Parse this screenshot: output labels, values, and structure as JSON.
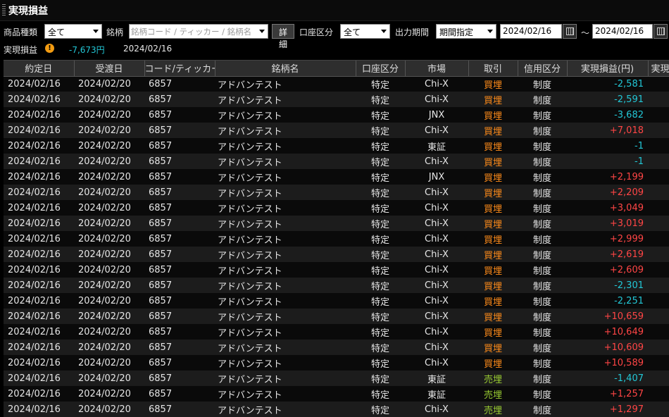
{
  "window": {
    "title": "実現損益"
  },
  "filters": {
    "product_type_label": "商品種類",
    "product_type_value": "全て",
    "symbol_label": "銘柄",
    "symbol_placeholder": "銘柄コード / ティッカー / 銘柄名",
    "detail_button": "詳細",
    "account_label": "口座区分",
    "account_value": "全て",
    "period_label": "出力期間",
    "period_value": "期間指定",
    "date_from": "2024/02/16",
    "range_sep": "～",
    "date_to": "2024/02/16"
  },
  "summary": {
    "label": "実現損益",
    "warn_icon": "!",
    "amount": "-7,673円",
    "date": "2024/02/16"
  },
  "table": {
    "columns": [
      "約定日",
      "受渡日",
      "コード/ティッカー",
      "銘柄名",
      "口座区分",
      "市場",
      "取引",
      "信用区分",
      "実現損益(円)",
      "実現"
    ],
    "rows": [
      [
        "2024/02/16",
        "2024/02/20",
        "6857",
        "アドバンテスト",
        "特定",
        "Chi-X",
        "買埋",
        "制度",
        "-2,581"
      ],
      [
        "2024/02/16",
        "2024/02/20",
        "6857",
        "アドバンテスト",
        "特定",
        "Chi-X",
        "買埋",
        "制度",
        "-2,591"
      ],
      [
        "2024/02/16",
        "2024/02/20",
        "6857",
        "アドバンテスト",
        "特定",
        "JNX",
        "買埋",
        "制度",
        "-3,682"
      ],
      [
        "2024/02/16",
        "2024/02/20",
        "6857",
        "アドバンテスト",
        "特定",
        "Chi-X",
        "買埋",
        "制度",
        "+7,018"
      ],
      [
        "2024/02/16",
        "2024/02/20",
        "6857",
        "アドバンテスト",
        "特定",
        "東証",
        "買埋",
        "制度",
        "-1"
      ],
      [
        "2024/02/16",
        "2024/02/20",
        "6857",
        "アドバンテスト",
        "特定",
        "Chi-X",
        "買埋",
        "制度",
        "-1"
      ],
      [
        "2024/02/16",
        "2024/02/20",
        "6857",
        "アドバンテスト",
        "特定",
        "JNX",
        "買埋",
        "制度",
        "+2,199"
      ],
      [
        "2024/02/16",
        "2024/02/20",
        "6857",
        "アドバンテスト",
        "特定",
        "Chi-X",
        "買埋",
        "制度",
        "+2,209"
      ],
      [
        "2024/02/16",
        "2024/02/20",
        "6857",
        "アドバンテスト",
        "特定",
        "Chi-X",
        "買埋",
        "制度",
        "+3,049"
      ],
      [
        "2024/02/16",
        "2024/02/20",
        "6857",
        "アドバンテスト",
        "特定",
        "Chi-X",
        "買埋",
        "制度",
        "+3,019"
      ],
      [
        "2024/02/16",
        "2024/02/20",
        "6857",
        "アドバンテスト",
        "特定",
        "Chi-X",
        "買埋",
        "制度",
        "+2,999"
      ],
      [
        "2024/02/16",
        "2024/02/20",
        "6857",
        "アドバンテスト",
        "特定",
        "Chi-X",
        "買埋",
        "制度",
        "+2,619"
      ],
      [
        "2024/02/16",
        "2024/02/20",
        "6857",
        "アドバンテスト",
        "特定",
        "Chi-X",
        "買埋",
        "制度",
        "+2,609"
      ],
      [
        "2024/02/16",
        "2024/02/20",
        "6857",
        "アドバンテスト",
        "特定",
        "Chi-X",
        "買埋",
        "制度",
        "-2,301"
      ],
      [
        "2024/02/16",
        "2024/02/20",
        "6857",
        "アドバンテスト",
        "特定",
        "Chi-X",
        "買埋",
        "制度",
        "-2,251"
      ],
      [
        "2024/02/16",
        "2024/02/20",
        "6857",
        "アドバンテスト",
        "特定",
        "Chi-X",
        "買埋",
        "制度",
        "+10,659"
      ],
      [
        "2024/02/16",
        "2024/02/20",
        "6857",
        "アドバンテスト",
        "特定",
        "Chi-X",
        "買埋",
        "制度",
        "+10,649"
      ],
      [
        "2024/02/16",
        "2024/02/20",
        "6857",
        "アドバンテスト",
        "特定",
        "Chi-X",
        "買埋",
        "制度",
        "+10,609"
      ],
      [
        "2024/02/16",
        "2024/02/20",
        "6857",
        "アドバンテスト",
        "特定",
        "Chi-X",
        "買埋",
        "制度",
        "+10,589"
      ],
      [
        "2024/02/16",
        "2024/02/20",
        "6857",
        "アドバンテスト",
        "特定",
        "東証",
        "売埋",
        "制度",
        "-1,407"
      ],
      [
        "2024/02/16",
        "2024/02/20",
        "6857",
        "アドバンテスト",
        "特定",
        "東証",
        "売埋",
        "制度",
        "+1,257"
      ],
      [
        "2024/02/16",
        "2024/02/20",
        "6857",
        "アドバンテスト",
        "特定",
        "Chi-X",
        "売埋",
        "制度",
        "+1,297"
      ]
    ]
  },
  "icons": {
    "calendar": "calendar-icon",
    "dropdown": "chevron-down-icon",
    "warning": "warning-icon"
  },
  "colors": {
    "negative": "#22c7d6",
    "positive": "#ff4545",
    "buy_close": "#ff8c1a",
    "sell_close": "#9acd32"
  }
}
